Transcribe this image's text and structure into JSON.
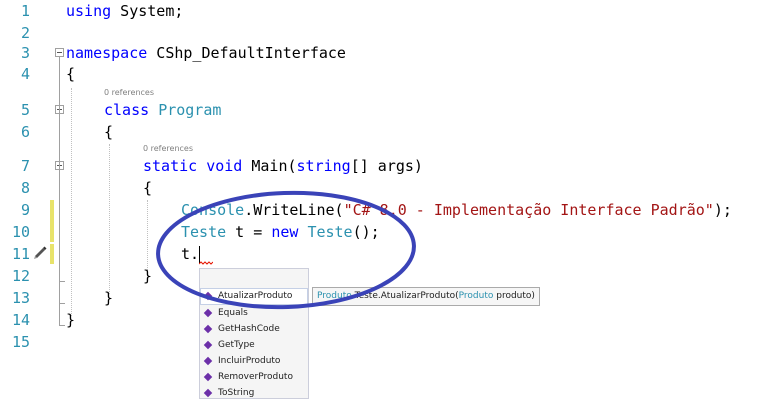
{
  "line_numbers": [
    "1",
    "2",
    "3",
    "4",
    "5",
    "6",
    "7",
    "8",
    "9",
    "10",
    "11",
    "12",
    "13",
    "14",
    "15"
  ],
  "code": {
    "l1": {
      "kw": "using",
      "rest": " System;"
    },
    "l3": {
      "kw": "namespace",
      "rest": " CShp_DefaultInterface"
    },
    "l4": "{",
    "l5": {
      "kw": "class",
      "type": "Program"
    },
    "l6": "{",
    "l7": {
      "kw1": "static",
      "kw2": "void",
      "name": " Main(",
      "kw3": "string",
      "rest": "[] args)"
    },
    "l8": "{",
    "l9": {
      "type": "Console",
      "call": ".WriteLine(",
      "str": "\"C# 8.0 - Implementação Interface Padrão\"",
      "end": ");"
    },
    "l10": {
      "type1": "Teste",
      "mid": " t = ",
      "kw": "new",
      "type2": "Teste",
      "end": "();"
    },
    "l11": "t.",
    "l12": "}",
    "l13": "}",
    "l14": "}"
  },
  "codelens": {
    "program_refs": "0 references",
    "main_refs": "0 references"
  },
  "completion": {
    "items": [
      "AtualizarProduto",
      "Equals",
      "GetHashCode",
      "GetType",
      "IncluirProduto",
      "RemoverProduto",
      "ToString"
    ],
    "selected_index": 0,
    "item_icon": "method-icon"
  },
  "tooltip": {
    "type1": "Produto",
    "method": " Teste.AtualizarProduto(",
    "type2": "Produto",
    "param": " produto)"
  },
  "colors": {
    "keyword": "#0000ff",
    "type": "#2b91af",
    "string": "#a31515",
    "line_number": "#2b91af",
    "annotation": "#3a43b8"
  }
}
